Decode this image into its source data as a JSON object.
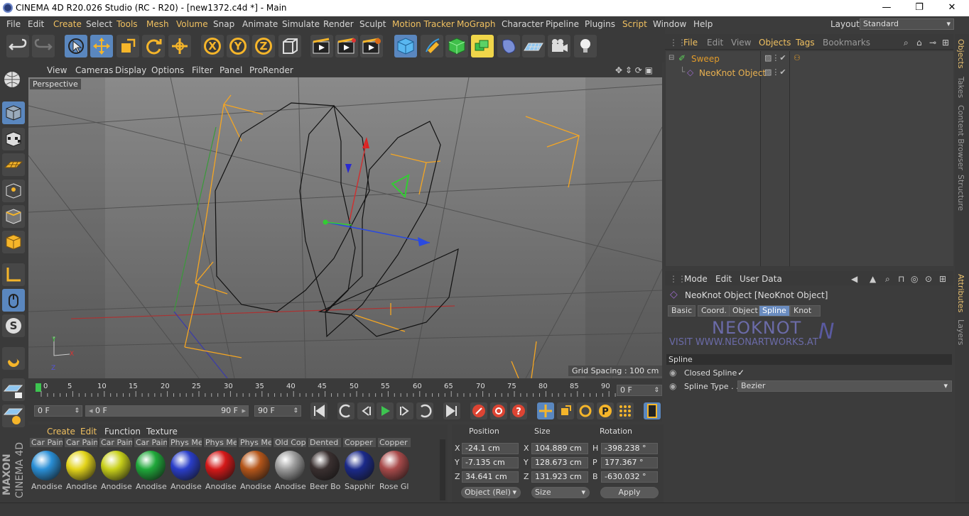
{
  "window": {
    "title": "CINEMA 4D R20.026 Studio (RC - R20) - [new1372.c4d *] - Main",
    "minimize": "—",
    "maximize": "❐",
    "close": "✕"
  },
  "menu": [
    "File",
    "Edit",
    "Create",
    "Select",
    "Tools",
    "Mesh",
    "Volume",
    "Snap",
    "Animate",
    "Simulate",
    "Render",
    "Sculpt",
    "Motion Tracker",
    "MoGraph",
    "Character",
    "Pipeline",
    "Plugins",
    "Script",
    "Window",
    "Help"
  ],
  "layout": {
    "label": "Layout:",
    "value": "Standard"
  },
  "viewport": {
    "menu": [
      "View",
      "Cameras",
      "Display",
      "Options",
      "Filter",
      "Panel",
      "ProRender"
    ],
    "camera": "Perspective",
    "grid_spacing": "Grid Spacing : 100 cm"
  },
  "timeline": {
    "ticks": [
      "0",
      "5",
      "10",
      "15",
      "20",
      "25",
      "30",
      "35",
      "40",
      "45",
      "50",
      "55",
      "60",
      "65",
      "70",
      "75",
      "80",
      "85",
      "90"
    ],
    "current": "0 F"
  },
  "playback": {
    "start": "0 F",
    "range_start": "0 F",
    "range_end": "90 F",
    "end": "90 F"
  },
  "materials": {
    "menu": [
      "Create",
      "Edit",
      "Function",
      "Texture"
    ],
    "items": [
      {
        "top": "Car Pain",
        "bottom": "Anodise",
        "color": "#2a8fd6"
      },
      {
        "top": "Car Pain",
        "bottom": "Anodise",
        "color": "#e3d41a"
      },
      {
        "top": "Car Pain",
        "bottom": "Anodise",
        "color": "#c8d01a"
      },
      {
        "top": "Car Pain",
        "bottom": "Anodise",
        "color": "#1fa83a"
      },
      {
        "top": "Phys Me",
        "bottom": "Anodise",
        "color": "#2a3ec9"
      },
      {
        "top": "Phys Me",
        "bottom": "Anodise",
        "color": "#d41818"
      },
      {
        "top": "Phys Me",
        "bottom": "Anodise",
        "color": "#b5561a"
      },
      {
        "top": "Old Cop",
        "bottom": "Anodise",
        "color": "#9c9c9c"
      },
      {
        "top": "Dented",
        "bottom": "Beer Bo",
        "color": "#3a3030"
      },
      {
        "top": "Copper",
        "bottom": "Sapphir",
        "color": "#1b2a8a"
      },
      {
        "top": "Copper",
        "bottom": "Rose Gl",
        "color": "#a84a4a"
      }
    ]
  },
  "coords": {
    "headers": [
      "Position",
      "Size",
      "Rotation"
    ],
    "rows": [
      {
        "axis": "X",
        "pos": "-24.1 cm",
        "saxis": "X",
        "size": "104.889 cm",
        "raxis": "H",
        "rot": "-398.238 °"
      },
      {
        "axis": "Y",
        "pos": "-7.135 cm",
        "saxis": "Y",
        "size": "128.673 cm",
        "raxis": "P",
        "rot": "177.367 °"
      },
      {
        "axis": "Z",
        "pos": "34.641 cm",
        "saxis": "Z",
        "size": "131.923 cm",
        "raxis": "B",
        "rot": "-630.032 °"
      }
    ],
    "mode": "Object (Rel)",
    "size_mode": "Size",
    "apply": "Apply"
  },
  "objects": {
    "menu": [
      "File",
      "Edit",
      "View",
      "Objects",
      "Tags",
      "Bookmarks"
    ],
    "items": [
      {
        "name": "Sweep",
        "color": "#e09a2a"
      },
      {
        "name": "NeoKnot Object",
        "color": "#e8b050"
      }
    ]
  },
  "attributes": {
    "menu": [
      "Mode",
      "Edit",
      "User Data"
    ],
    "title": "NeoKnot Object [NeoKnot Object]",
    "tabs": [
      "Basic",
      "Coord.",
      "Object",
      "Spline",
      "Knot"
    ],
    "active_tab": "Spline",
    "logo_text": "NEOKNOT",
    "logo_sub": "VISIT WWW.NEONARTWORKS.AT",
    "section": "Spline",
    "closed_label": "Closed Spline",
    "closed_check": "✓",
    "type_label": "Spline Type . .",
    "type_value": "Bezier"
  },
  "side_tabs": [
    "Objects",
    "Takes",
    "Content Browser",
    "Structure"
  ],
  "side_tabs2": [
    "Attributes",
    "Layers"
  ],
  "logo": [
    "MAXON",
    "CINEMA 4D"
  ]
}
